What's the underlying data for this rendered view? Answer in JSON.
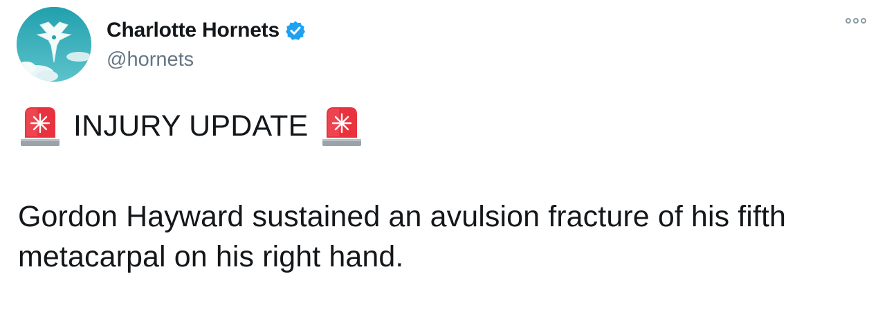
{
  "author": {
    "display_name": "Charlotte Hornets",
    "handle": "@hornets",
    "verified": true,
    "avatar_icon": "hornets-logo-icon",
    "avatar_color": "#2aa6b0",
    "verified_color": "#1da1f2"
  },
  "menu": {
    "icon": "more-options-icon"
  },
  "tweet": {
    "headline": "INJURY UPDATE",
    "headline_emoji": "rotating-light-icon",
    "body": "Gordon Hayward sustained an avulsion fracture of his fifth metacarpal on his right hand."
  },
  "colors": {
    "text": "#14171a",
    "secondary_text": "#657786",
    "siren_red": "#e8333f"
  }
}
